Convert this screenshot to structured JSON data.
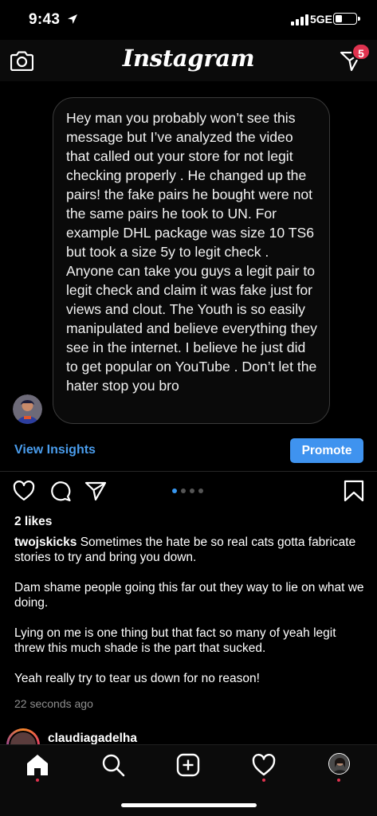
{
  "status_bar": {
    "time": "9:43",
    "network": "5GE",
    "battery_level": 0.35
  },
  "header": {
    "title": "Instagram",
    "dm_badge_count": "5",
    "icons": [
      "camera-icon",
      "direct-message-icon"
    ]
  },
  "post": {
    "message_text": "Hey man you probably won’t see this message but I’ve analyzed the video that called out your store for not legit checking properly . He changed up the pairs! the fake pairs he bought were not the same pairs he took to UN. For example DHL package was size 10 TS6 but took a size 5y to legit check . Anyone can take you guys a legit pair to legit check and claim it was fake just for views and clout. The Youth is so easily manipulated and believe everything they see in the internet. I believe he just did to get popular on YouTube . Don’t let the hater stop you bro",
    "view_insights_label": "View Insights",
    "promote_label": "Promote",
    "carousel": {
      "count": 4,
      "active_index": 0
    },
    "likes": "2 likes",
    "caption_user": "twojskicks",
    "caption_first": " Sometimes the hate be so real cats gotta fabricate stories to try and bring you down.",
    "caption_paragraphs": [
      "Dam shame people going this far out they way to lie on what we doing.",
      "Lying on me is one thing but that fact so many of yeah legit threw this much shade is the part that sucked.",
      "Yeah really try to tear us down for no reason!"
    ],
    "timestamp": "22 seconds ago"
  },
  "next_post": {
    "username": "claudiagadelha"
  },
  "tab_bar": {
    "items": [
      "home-icon",
      "search-icon",
      "create-post-icon",
      "activity-heart-icon",
      "profile-avatar"
    ]
  },
  "colors": {
    "accent_blue": "#3f93ef",
    "link_blue": "#4a9ded",
    "badge_red": "#e0334f",
    "background": "#000000"
  }
}
